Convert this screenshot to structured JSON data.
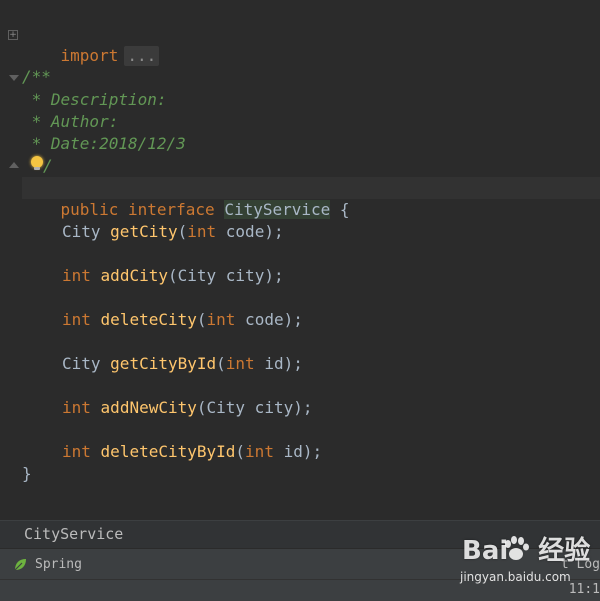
{
  "code": {
    "import_kw": "import",
    "import_fold": "...",
    "doc_open": "/**",
    "doc_desc": " * Description:",
    "doc_author": " * Author:",
    "doc_date": " * Date:2018/12/3",
    "doc_close": "/",
    "decl_public": "public",
    "decl_interface": "interface",
    "decl_name": "CityService",
    "decl_brace": " {",
    "close_brace": "}",
    "methods": [
      {
        "ret": "City",
        "ret_is_kw": false,
        "name": "getCity",
        "p_type": "int",
        "p_type_is_kw": true,
        "p_name": " code);"
      },
      {
        "ret": "int",
        "ret_is_kw": true,
        "name": "addCity",
        "p_type": "City",
        "p_type_is_kw": false,
        "p_name": " city);"
      },
      {
        "ret": "int",
        "ret_is_kw": true,
        "name": "deleteCity",
        "p_type": "int",
        "p_type_is_kw": true,
        "p_name": " code);"
      },
      {
        "ret": "City",
        "ret_is_kw": false,
        "name": "getCityById",
        "p_type": "int",
        "p_type_is_kw": true,
        "p_name": " id);"
      },
      {
        "ret": "int",
        "ret_is_kw": true,
        "name": "addNewCity",
        "p_type": "City",
        "p_type_is_kw": false,
        "p_name": " city);"
      },
      {
        "ret": "int",
        "ret_is_kw": true,
        "name": "deleteCityById",
        "p_type": "int",
        "p_type_is_kw": true,
        "p_name": " id);"
      }
    ]
  },
  "breadcrumb": {
    "item": "CityService"
  },
  "toolwindow": {
    "spring_label": "Spring",
    "right_label": "t Log"
  },
  "status": {
    "position": "11:1"
  },
  "watermark": {
    "logo_text": "Bai",
    "logo_cn": "经验",
    "url": "jingyan.baidu.com"
  },
  "icons": {
    "spring": "spring-leaf-icon",
    "bulb": "lightbulb-icon"
  },
  "colors": {
    "keyword": "#cc7832",
    "method": "#ffc66d",
    "doc_comment": "#629755",
    "text": "#a9b7c6",
    "background": "#2b2b2b"
  }
}
